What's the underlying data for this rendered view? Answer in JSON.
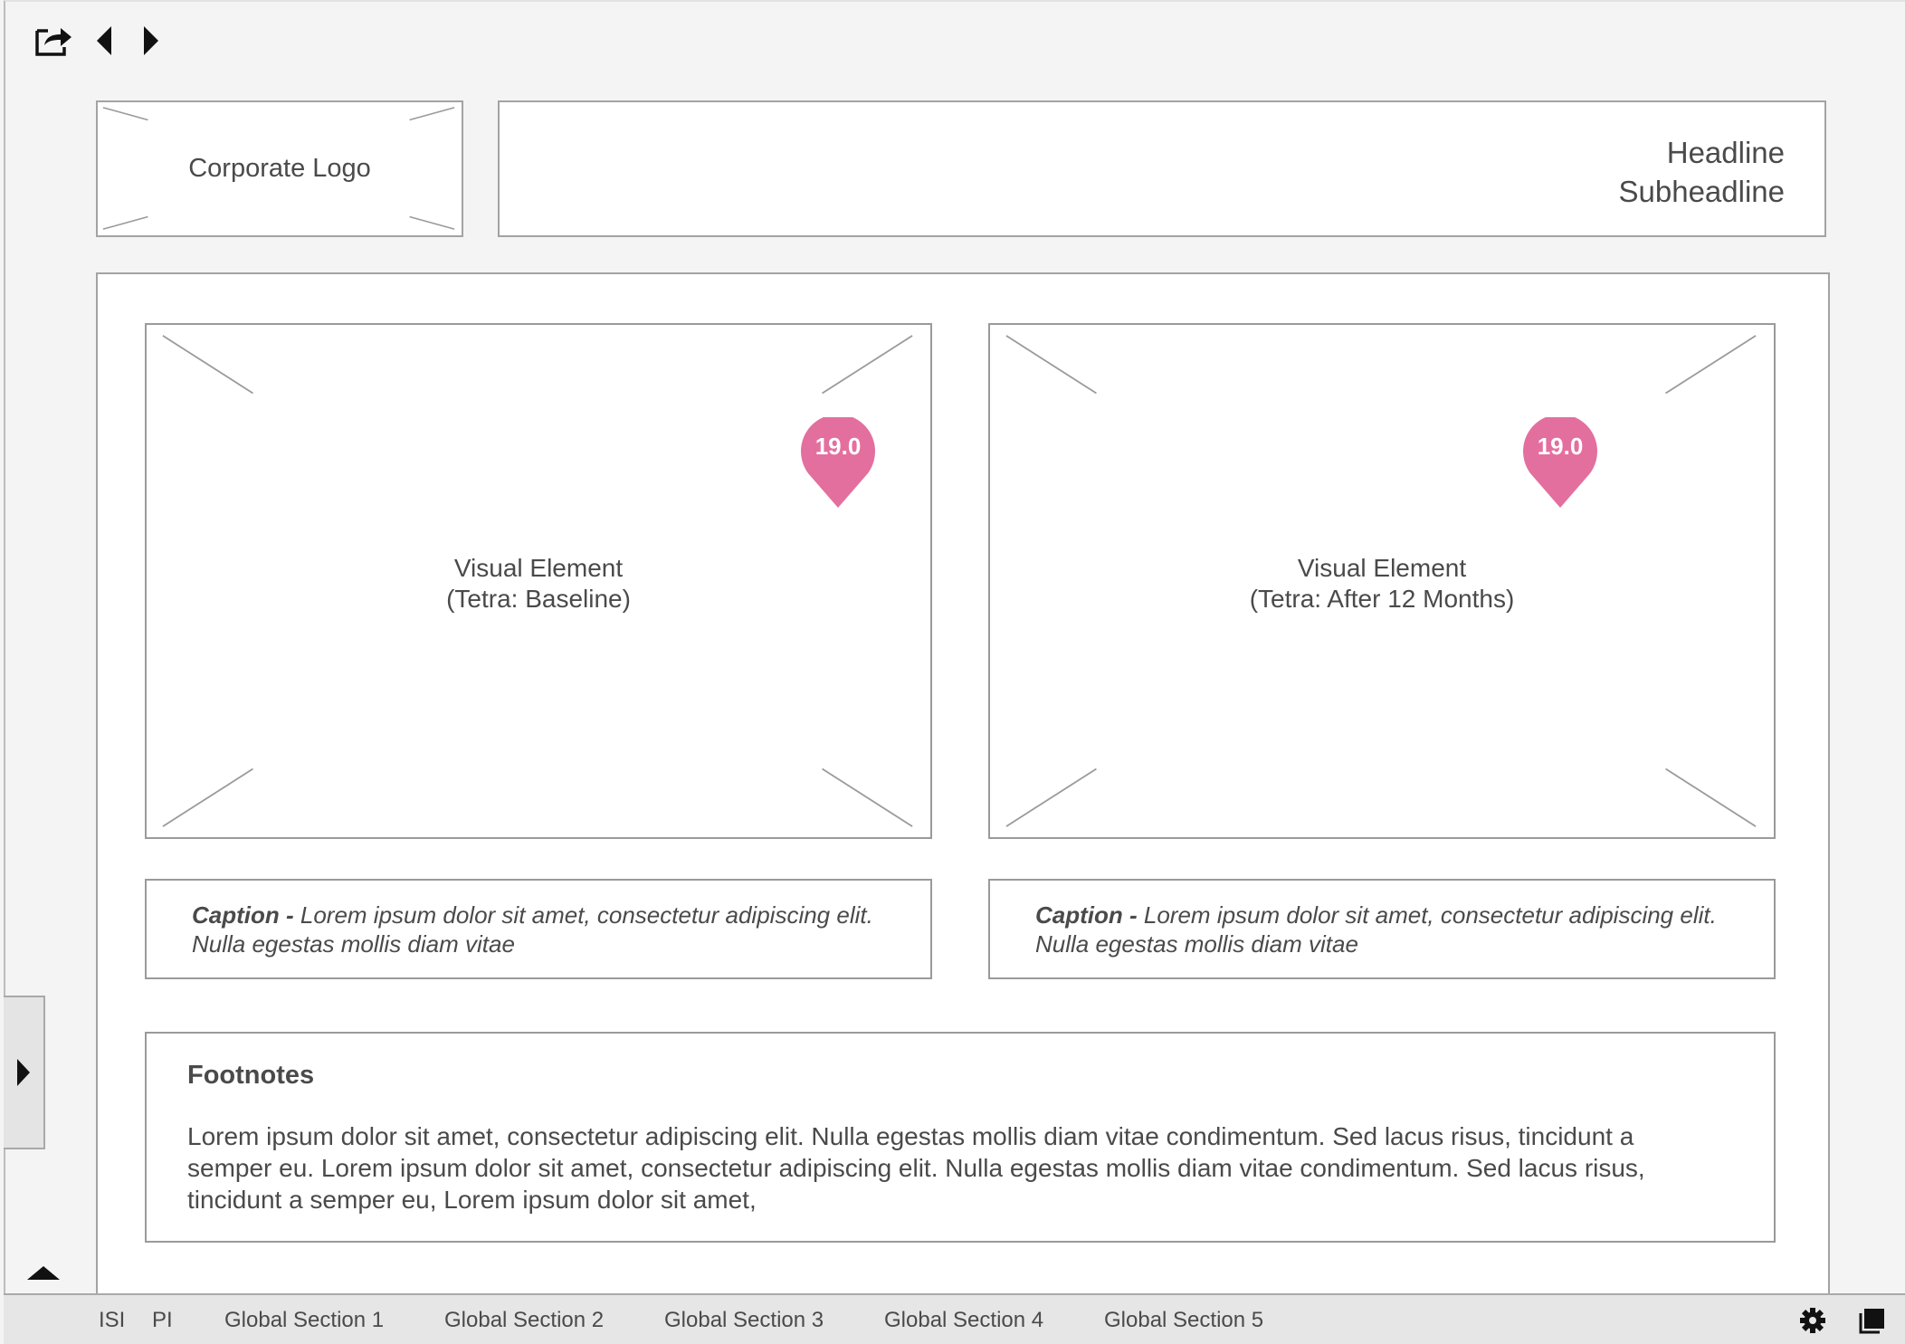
{
  "toolbar": {
    "icons": [
      "share-icon",
      "triangle-left-icon",
      "triangle-right-icon"
    ]
  },
  "header": {
    "logo_label": "Corporate Logo",
    "headline": "Headline",
    "subheadline": "Subheadline"
  },
  "visuals": [
    {
      "title": "Visual Element",
      "subtitle": "(Tetra: Baseline)",
      "pin_label": "19.0"
    },
    {
      "title": "Visual Element",
      "subtitle": "(Tetra: After 12 Months)",
      "pin_label": "19.0"
    }
  ],
  "captions": [
    {
      "label": "Caption - ",
      "text": "Lorem ipsum dolor sit amet, consectetur adipiscing elit. Nulla egestas mollis diam vitae"
    },
    {
      "label": "Caption - ",
      "text": "Lorem ipsum dolor sit amet, consectetur adipiscing elit. Nulla egestas mollis diam vitae"
    }
  ],
  "footnotes": {
    "title": "Footnotes",
    "body": "Lorem ipsum dolor sit amet, consectetur adipiscing elit. Nulla egestas mollis diam vitae condimentum. Sed lacus risus, tincidunt a semper eu. Lorem ipsum dolor sit amet, consectetur adipiscing elit. Nulla egestas mollis diam vitae condimentum. Sed lacus risus, tincidunt a semper eu, Lorem ipsum dolor sit amet,"
  },
  "bottom_nav": {
    "items": [
      "ISI",
      "PI",
      "Global Section 1",
      "Global Section 2",
      "Global Section 3",
      "Global Section 4",
      "Global Section 5"
    ],
    "right_icons": [
      "gear-icon",
      "pages-icon"
    ]
  },
  "colors": {
    "pin": "#e36f9f",
    "border": "#9a9a9a",
    "text": "#4a4a4a"
  }
}
